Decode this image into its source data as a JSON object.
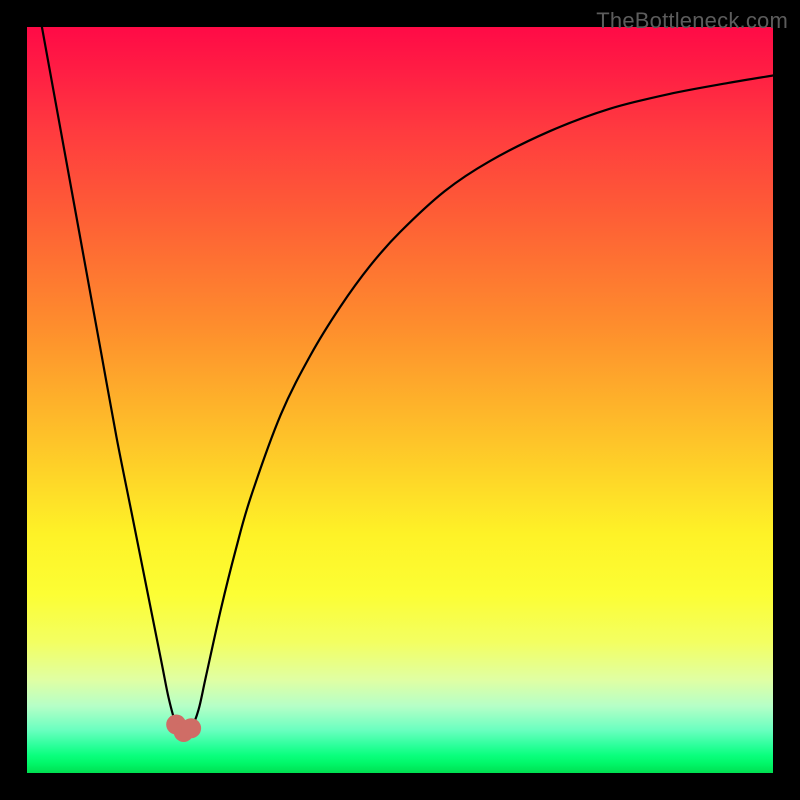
{
  "watermark": "TheBottleneck.com",
  "colors": {
    "frame": "#000000",
    "curve_stroke": "#000000",
    "dot_fill": "#cf6d66",
    "gradient_top": "#ff0a46",
    "gradient_bottom": "#00de50"
  },
  "chart_data": {
    "type": "line",
    "title": "",
    "xlabel": "",
    "ylabel": "",
    "xlim": [
      0,
      100
    ],
    "ylim": [
      0,
      100
    ],
    "series": [
      {
        "name": "bottleneck-curve",
        "x": [
          2,
          4,
          6,
          8,
          10,
          12,
          14,
          16,
          18,
          19,
          20,
          21,
          22,
          23,
          24,
          26,
          28,
          30,
          34,
          38,
          42,
          46,
          50,
          56,
          62,
          70,
          78,
          86,
          94,
          100
        ],
        "y": [
          100,
          89,
          78,
          67,
          56,
          45,
          35,
          25,
          15,
          10,
          6.5,
          5.5,
          6.0,
          8.5,
          13,
          22,
          30,
          37,
          48,
          56,
          62.5,
          68,
          72.5,
          78,
          82,
          86,
          89,
          91,
          92.5,
          93.5
        ]
      }
    ],
    "markers": [
      {
        "name": "min-left",
        "x": 20,
        "y": 6.5
      },
      {
        "name": "min-bottom",
        "x": 21,
        "y": 5.5
      },
      {
        "name": "min-right",
        "x": 22,
        "y": 6.0
      }
    ]
  }
}
